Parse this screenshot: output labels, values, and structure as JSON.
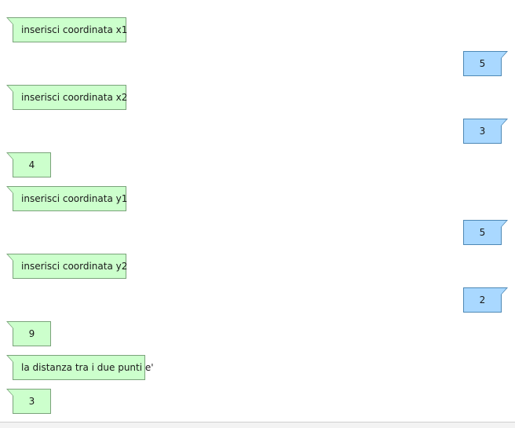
{
  "messages": [
    {
      "side": "left",
      "text": "inserisci coordinata x1"
    },
    {
      "side": "right",
      "text": "5"
    },
    {
      "side": "left",
      "text": "inserisci coordinata x2"
    },
    {
      "side": "right",
      "text": "3"
    },
    {
      "side": "left",
      "text": "4"
    },
    {
      "side": "left",
      "text": "inserisci coordinata y1"
    },
    {
      "side": "right",
      "text": "5"
    },
    {
      "side": "left",
      "text": "inserisci coordinata y2"
    },
    {
      "side": "right",
      "text": "2"
    },
    {
      "side": "left",
      "text": "9"
    },
    {
      "side": "left",
      "text": "la distanza tra i due punti e'"
    },
    {
      "side": "left",
      "text": "3"
    }
  ],
  "colors": {
    "output_bubble": "#ccffcc",
    "input_bubble": "#a9d8ff"
  }
}
